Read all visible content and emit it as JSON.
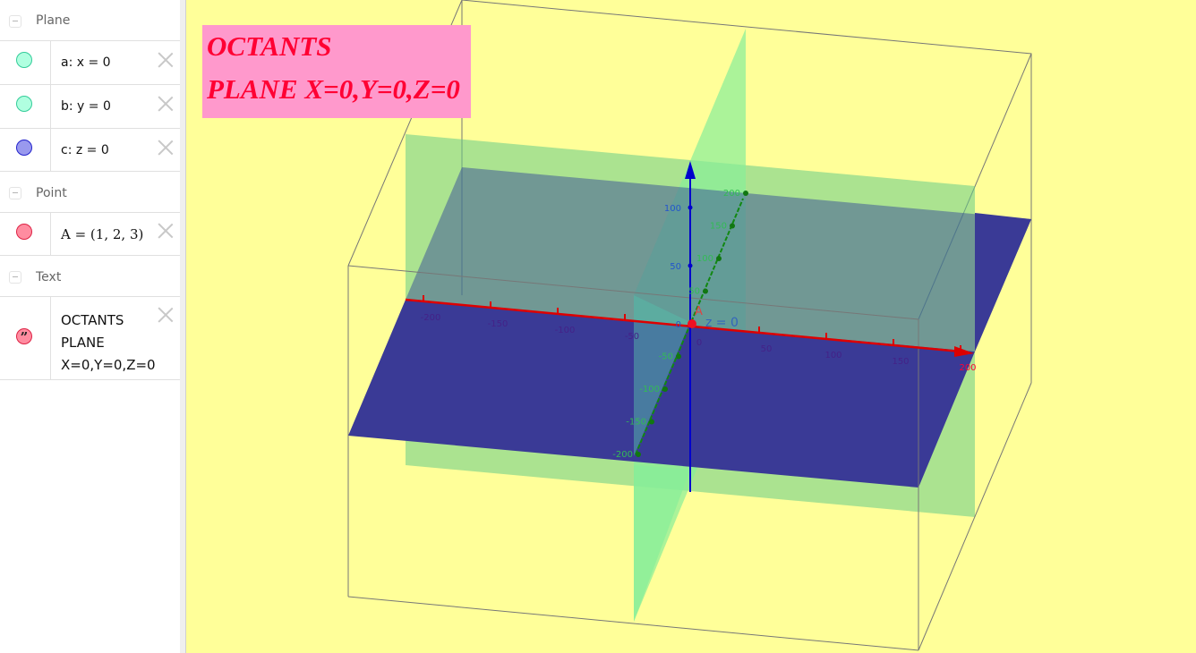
{
  "algebra_view": {
    "groups": [
      {
        "name": "Plane",
        "items": [
          {
            "expression": "a: x = 0",
            "color": "#b0ffe0",
            "border": "#33cc99"
          },
          {
            "expression": "b: y = 0",
            "color": "#b0ffe0",
            "border": "#33cc99"
          },
          {
            "expression": "c: z = 0",
            "color": "#9999ee",
            "border": "#2222cc"
          }
        ]
      },
      {
        "name": "Point",
        "items": [
          {
            "expression": "A = (1, 2, 3)",
            "color": "#ff8ca0",
            "border": "#dd2244"
          }
        ]
      },
      {
        "name": "Text",
        "items": [
          {
            "lines": [
              "OCTANTS",
              "PLANE",
              "X=0,Y=0,Z=0"
            ],
            "icon": "quote-icon",
            "color": "#ff8ca0",
            "border": "#dd2244",
            "glyph": "”"
          }
        ]
      }
    ]
  },
  "graphics_3d": {
    "background": "#ffff99",
    "title_text": {
      "line1": "OCTANTS",
      "line2": "PLANE X=0,Y=0,Z=0",
      "background": "#ff99cc",
      "color": "#ff0033"
    },
    "plane_label": "z = 0",
    "point_label": "A",
    "x_axis": {
      "color": "#dd0000",
      "ticks": [
        "-200",
        "-150",
        "-100",
        "-50",
        "0",
        "50",
        "100",
        "150",
        "200"
      ]
    },
    "y_axis": {
      "color": "#008800",
      "ticks": [
        "-200",
        "-150",
        "-100",
        "-50",
        "50",
        "100",
        "150",
        "200"
      ]
    },
    "z_axis": {
      "color": "#0000cc",
      "ticks": [
        "0",
        "50",
        "100"
      ]
    },
    "plane_colors": {
      "x0": "#66ee99",
      "y0": "#33cc99",
      "z0": "#2b2b99"
    }
  }
}
